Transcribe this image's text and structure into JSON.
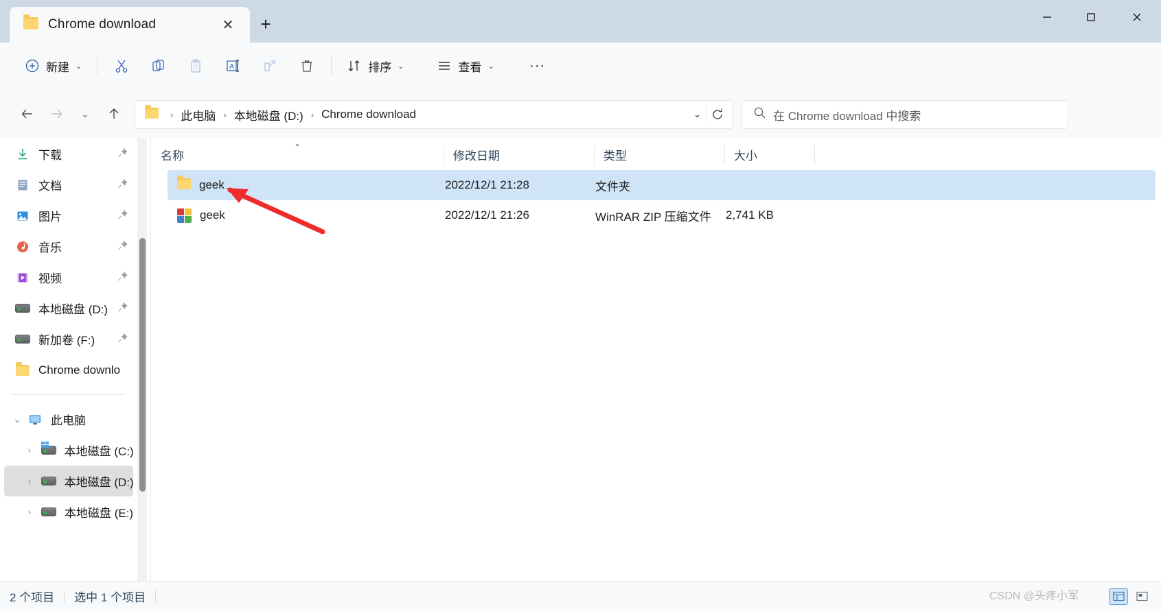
{
  "window": {
    "tab_title": "Chrome download",
    "tab_close": "✕",
    "new_tab": "+",
    "minimize": "—",
    "maximize": "▢",
    "close": "✕"
  },
  "toolbar": {
    "new_label": "新建",
    "new_chevron": "⌄",
    "cut_label": "剪切",
    "copy_label": "复制",
    "paste_label": "粘贴",
    "rename_label": "重命名",
    "share_label": "共享",
    "delete_label": "删除",
    "sort_label": "排序",
    "sort_chevron": "⌄",
    "view_label": "查看",
    "view_chevron": "⌄",
    "more_label": "···"
  },
  "nav": {
    "back": "←",
    "forward": "→",
    "recent": "⌄",
    "up": "↑"
  },
  "address": {
    "crumbs": [
      "此电脑",
      "本地磁盘 (D:)",
      "Chrome download"
    ],
    "separator": "›",
    "dropdown_chevron": "⌄",
    "refresh": "⟳"
  },
  "search": {
    "placeholder": "在 Chrome download 中搜索"
  },
  "sidebar": {
    "quick_items": [
      {
        "label": "下载",
        "icon": "download-icon",
        "pinned": true
      },
      {
        "label": "文档",
        "icon": "documents-icon",
        "pinned": true
      },
      {
        "label": "图片",
        "icon": "pictures-icon",
        "pinned": true
      },
      {
        "label": "音乐",
        "icon": "music-icon",
        "pinned": true
      },
      {
        "label": "视频",
        "icon": "videos-icon",
        "pinned": true
      },
      {
        "label": "本地磁盘 (D:)",
        "icon": "drive-icon",
        "pinned": true
      },
      {
        "label": "新加卷 (F:)",
        "icon": "drive-icon",
        "pinned": true
      },
      {
        "label": "Chrome downlo",
        "icon": "folder-icon",
        "pinned": false
      }
    ],
    "this_pc": {
      "label": "此电脑",
      "icon": "this-pc-icon",
      "expanded": "⌄"
    },
    "drives": [
      {
        "label": "本地磁盘 (C:)",
        "expander": "›",
        "selected": false,
        "system": true
      },
      {
        "label": "本地磁盘 (D:)",
        "expander": "›",
        "selected": true,
        "system": false
      },
      {
        "label": "本地磁盘 (E:)",
        "expander": "›",
        "selected": false,
        "system": false
      }
    ],
    "pin_glyph": "📌"
  },
  "filelist": {
    "columns": [
      {
        "label": "名称",
        "sorted": "asc",
        "caret": "⌃"
      },
      {
        "label": "修改日期",
        "sorted": "",
        "caret": ""
      },
      {
        "label": "类型",
        "sorted": "",
        "caret": ""
      },
      {
        "label": "大小",
        "sorted": "",
        "caret": ""
      }
    ],
    "rows": [
      {
        "name": "geek",
        "modified": "2022/12/1 21:28",
        "type": "文件夹",
        "size": "",
        "icon": "folder-icon",
        "selected": true
      },
      {
        "name": "geek",
        "modified": "2022/12/1 21:26",
        "type": "WinRAR ZIP 压缩文件",
        "size": "2,741 KB",
        "icon": "zip-icon",
        "selected": false
      }
    ]
  },
  "status": {
    "count": "2 个项目",
    "selected": "选中 1 个项目",
    "watermark": "CSDN @头疼小军"
  }
}
